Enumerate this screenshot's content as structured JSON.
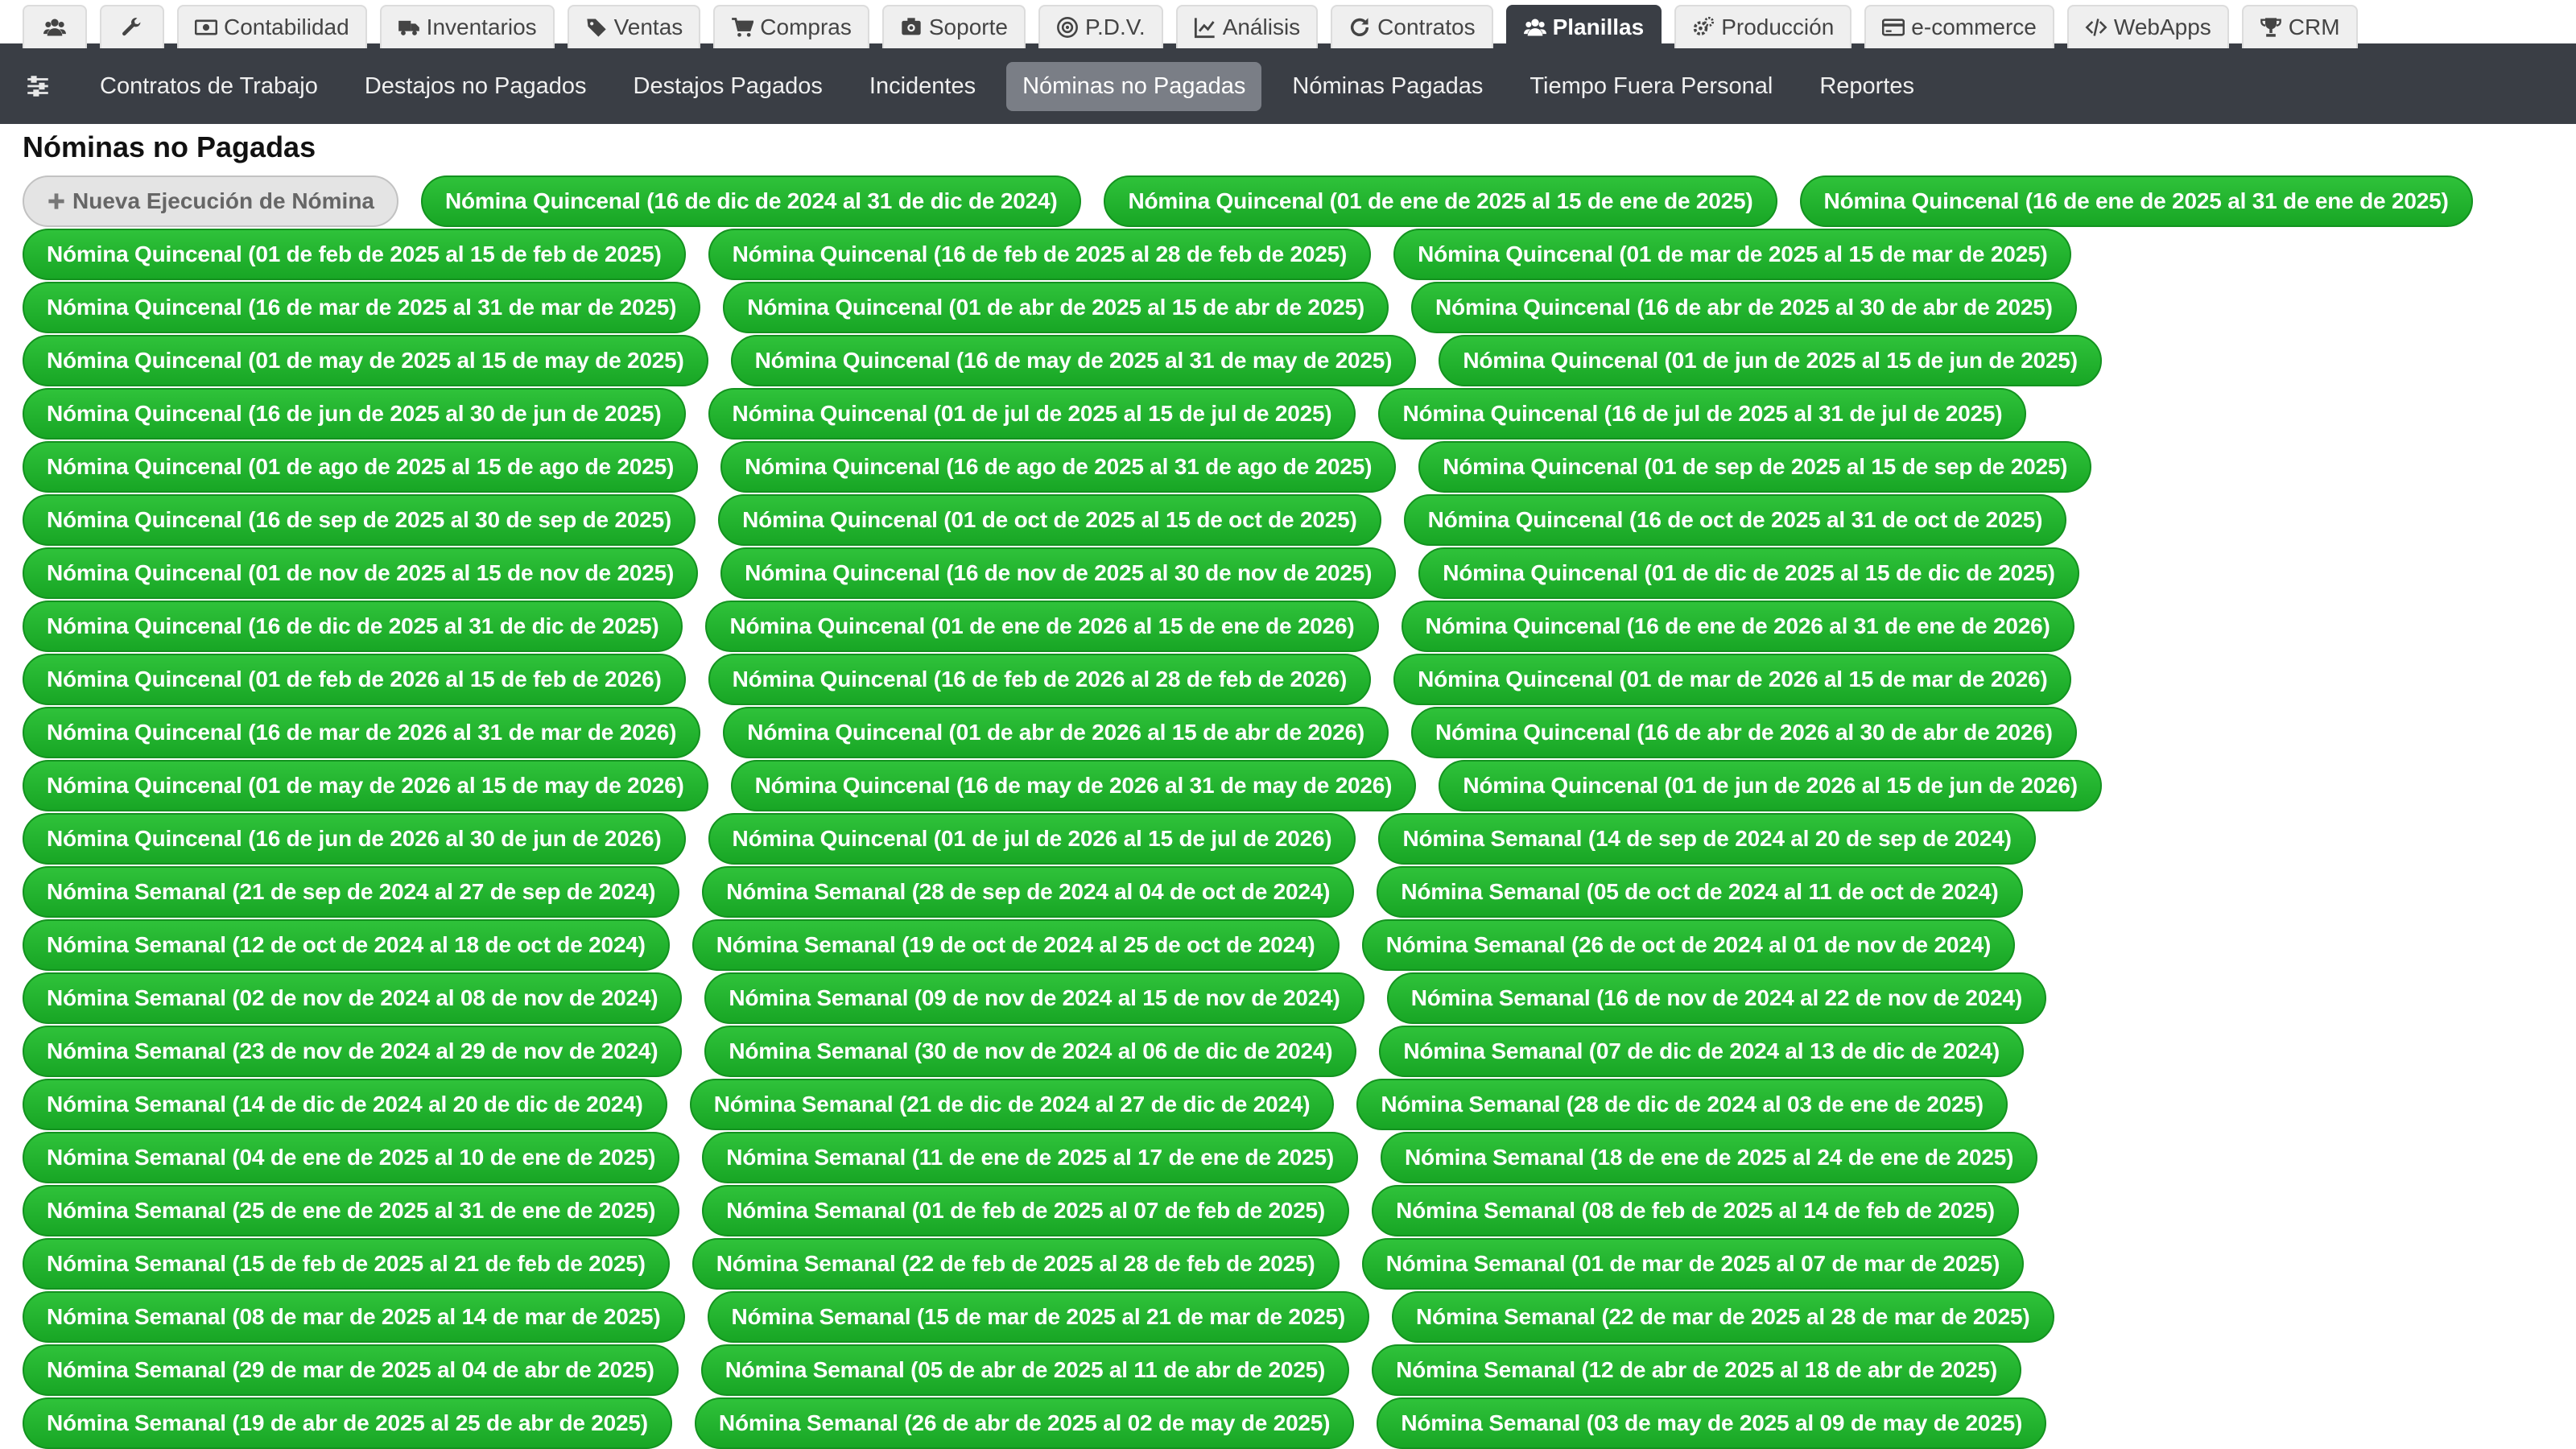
{
  "top_tabs": [
    {
      "icon": "users-icon",
      "label": ""
    },
    {
      "icon": "wrench-icon",
      "label": ""
    },
    {
      "icon": "money-icon",
      "label": "Contabilidad"
    },
    {
      "icon": "truck-icon",
      "label": "Inventarios"
    },
    {
      "icon": "tags-icon",
      "label": "Ventas"
    },
    {
      "icon": "cart-icon",
      "label": "Compras"
    },
    {
      "icon": "support-icon",
      "label": "Soporte"
    },
    {
      "icon": "pos-icon",
      "label": "P.D.V."
    },
    {
      "icon": "chart-icon",
      "label": "Análisis"
    },
    {
      "icon": "refresh-icon",
      "label": "Contratos"
    },
    {
      "icon": "users-icon",
      "label": "Planillas",
      "active": true
    },
    {
      "icon": "gears-icon",
      "label": "Producción"
    },
    {
      "icon": "card-icon",
      "label": "e-commerce"
    },
    {
      "icon": "code-icon",
      "label": "WebApps"
    },
    {
      "icon": "trophy-icon",
      "label": "CRM"
    }
  ],
  "sub_tabs": [
    {
      "label": "Contratos de Trabajo"
    },
    {
      "label": "Destajos no Pagados"
    },
    {
      "label": "Destajos Pagados"
    },
    {
      "label": "Incidentes"
    },
    {
      "label": "Nóminas no Pagadas",
      "active": true
    },
    {
      "label": "Nóminas Pagadas"
    },
    {
      "label": "Tiempo Fuera Personal"
    },
    {
      "label": "Reportes"
    }
  ],
  "page_title": "Nóminas no Pagadas",
  "new_run_label": "Nueva Ejecución de Nómina",
  "payrolls": [
    "Nómina Quincenal (16 de dic de 2024 al 31 de dic de 2024)",
    "Nómina Quincenal (01 de ene de 2025 al 15 de ene de 2025)",
    "Nómina Quincenal (16 de ene de 2025 al 31 de ene de 2025)",
    "Nómina Quincenal (01 de feb de 2025 al 15 de feb de 2025)",
    "Nómina Quincenal (16 de feb de 2025 al 28 de feb de 2025)",
    "Nómina Quincenal (01 de mar de 2025 al 15 de mar de 2025)",
    "Nómina Quincenal (16 de mar de 2025 al 31 de mar de 2025)",
    "Nómina Quincenal (01 de abr de 2025 al 15 de abr de 2025)",
    "Nómina Quincenal (16 de abr de 2025 al 30 de abr de 2025)",
    "Nómina Quincenal (01 de may de 2025 al 15 de may de 2025)",
    "Nómina Quincenal (16 de may de 2025 al 31 de may de 2025)",
    "Nómina Quincenal (01 de jun de 2025 al 15 de jun de 2025)",
    "Nómina Quincenal (16 de jun de 2025 al 30 de jun de 2025)",
    "Nómina Quincenal (01 de jul de 2025 al 15 de jul de 2025)",
    "Nómina Quincenal (16 de jul de 2025 al 31 de jul de 2025)",
    "Nómina Quincenal (01 de ago de 2025 al 15 de ago de 2025)",
    "Nómina Quincenal (16 de ago de 2025 al 31 de ago de 2025)",
    "Nómina Quincenal (01 de sep de 2025 al 15 de sep de 2025)",
    "Nómina Quincenal (16 de sep de 2025 al 30 de sep de 2025)",
    "Nómina Quincenal (01 de oct de 2025 al 15 de oct de 2025)",
    "Nómina Quincenal (16 de oct de 2025 al 31 de oct de 2025)",
    "Nómina Quincenal (01 de nov de 2025 al 15 de nov de 2025)",
    "Nómina Quincenal (16 de nov de 2025 al 30 de nov de 2025)",
    "Nómina Quincenal (01 de dic de 2025 al 15 de dic de 2025)",
    "Nómina Quincenal (16 de dic de 2025 al 31 de dic de 2025)",
    "Nómina Quincenal (01 de ene de 2026 al 15 de ene de 2026)",
    "Nómina Quincenal (16 de ene de 2026 al 31 de ene de 2026)",
    "Nómina Quincenal (01 de feb de 2026 al 15 de feb de 2026)",
    "Nómina Quincenal (16 de feb de 2026 al 28 de feb de 2026)",
    "Nómina Quincenal (01 de mar de 2026 al 15 de mar de 2026)",
    "Nómina Quincenal (16 de mar de 2026 al 31 de mar de 2026)",
    "Nómina Quincenal (01 de abr de 2026 al 15 de abr de 2026)",
    "Nómina Quincenal (16 de abr de 2026 al 30 de abr de 2026)",
    "Nómina Quincenal (01 de may de 2026 al 15 de may de 2026)",
    "Nómina Quincenal (16 de may de 2026 al 31 de may de 2026)",
    "Nómina Quincenal (01 de jun de 2026 al 15 de jun de 2026)",
    "Nómina Quincenal (16 de jun de 2026 al 30 de jun de 2026)",
    "Nómina Quincenal (01 de jul de 2026 al 15 de jul de 2026)",
    "Nómina Semanal (14 de sep de 2024 al 20 de sep de 2024)",
    "Nómina Semanal (21 de sep de 2024 al 27 de sep de 2024)",
    "Nómina Semanal (28 de sep de 2024 al 04 de oct de 2024)",
    "Nómina Semanal (05 de oct de 2024 al 11 de oct de 2024)",
    "Nómina Semanal (12 de oct de 2024 al 18 de oct de 2024)",
    "Nómina Semanal (19 de oct de 2024 al 25 de oct de 2024)",
    "Nómina Semanal (26 de oct de 2024 al 01 de nov de 2024)",
    "Nómina Semanal (02 de nov de 2024 al 08 de nov de 2024)",
    "Nómina Semanal (09 de nov de 2024 al 15 de nov de 2024)",
    "Nómina Semanal (16 de nov de 2024 al 22 de nov de 2024)",
    "Nómina Semanal (23 de nov de 2024 al 29 de nov de 2024)",
    "Nómina Semanal (30 de nov de 2024 al 06 de dic de 2024)",
    "Nómina Semanal (07 de dic de 2024 al 13 de dic de 2024)",
    "Nómina Semanal (14 de dic de 2024 al 20 de dic de 2024)",
    "Nómina Semanal (21 de dic de 2024 al 27 de dic de 2024)",
    "Nómina Semanal (28 de dic de 2024 al 03 de ene de 2025)",
    "Nómina Semanal (04 de ene de 2025 al 10 de ene de 2025)",
    "Nómina Semanal (11 de ene de 2025 al 17 de ene de 2025)",
    "Nómina Semanal (18 de ene de 2025 al 24 de ene de 2025)",
    "Nómina Semanal (25 de ene de 2025 al 31 de ene de 2025)",
    "Nómina Semanal (01 de feb de 2025 al 07 de feb de 2025)",
    "Nómina Semanal (08 de feb de 2025 al 14 de feb de 2025)",
    "Nómina Semanal (15 de feb de 2025 al 21 de feb de 2025)",
    "Nómina Semanal (22 de feb de 2025 al 28 de feb de 2025)",
    "Nómina Semanal (01 de mar de 2025 al 07 de mar de 2025)",
    "Nómina Semanal (08 de mar de 2025 al 14 de mar de 2025)",
    "Nómina Semanal (15 de mar de 2025 al 21 de mar de 2025)",
    "Nómina Semanal (22 de mar de 2025 al 28 de mar de 2025)",
    "Nómina Semanal (29 de mar de 2025 al 04 de abr de 2025)",
    "Nómina Semanal (05 de abr de 2025 al 11 de abr de 2025)",
    "Nómina Semanal (12 de abr de 2025 al 18 de abr de 2025)",
    "Nómina Semanal (19 de abr de 2025 al 25 de abr de 2025)",
    "Nómina Semanal (26 de abr de 2025 al 02 de may de 2025)",
    "Nómina Semanal (03 de may de 2025 al 09 de may de 2025)"
  ]
}
